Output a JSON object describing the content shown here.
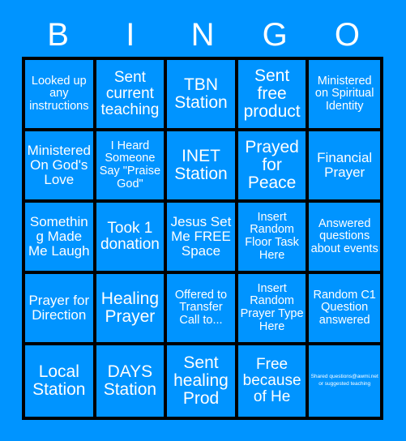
{
  "card": {
    "type": "bingo-card",
    "background_color": "#0094ff",
    "grid_line_color": "#000000",
    "text_color": "#ffffff",
    "columns": 5,
    "rows": 5
  },
  "header": {
    "letters": [
      "B",
      "I",
      "N",
      "G",
      "O"
    ]
  },
  "grid": {
    "cells": [
      {
        "text": "Looked up any instructions",
        "size": "sm"
      },
      {
        "text": "Sent current teaching",
        "size": "lg"
      },
      {
        "text": "TBN Station",
        "size": "xl"
      },
      {
        "text": "Sent free product",
        "size": "xl"
      },
      {
        "text": "Ministered on Spiritual Identity",
        "size": "sm"
      },
      {
        "text": "Ministered On God's Love",
        "size": "md"
      },
      {
        "text": "I Heard Someone Say \"Praise God\"",
        "size": "sm"
      },
      {
        "text": "INET Station",
        "size": "xl"
      },
      {
        "text": "Prayed for Peace",
        "size": "xl"
      },
      {
        "text": "Financial Prayer",
        "size": "md"
      },
      {
        "text": "Something Made Me Laugh",
        "size": "md"
      },
      {
        "text": "Took 1 donation",
        "size": "lg"
      },
      {
        "text": "Jesus Set Me FREE Space",
        "size": "md"
      },
      {
        "text": "Insert Random Floor Task Here",
        "size": "sm"
      },
      {
        "text": "Answered questions about events",
        "size": "sm"
      },
      {
        "text": "Prayer for Direction",
        "size": "md"
      },
      {
        "text": "Healing Prayer",
        "size": "xl"
      },
      {
        "text": "Offered to Transfer Call to...",
        "size": "sm"
      },
      {
        "text": "Insert Random Prayer Type Here",
        "size": "sm"
      },
      {
        "text": "Random C1 Question answered",
        "size": "sm"
      },
      {
        "text": "Local Station",
        "size": "xl"
      },
      {
        "text": "DAYS Station",
        "size": "xl"
      },
      {
        "text": "Sent healing Prod",
        "size": "xl"
      },
      {
        "text": "Free because of He",
        "size": "lg"
      },
      {
        "text": "Shared questions@awmi.net or suggested teaching",
        "size": "tiny"
      }
    ]
  }
}
